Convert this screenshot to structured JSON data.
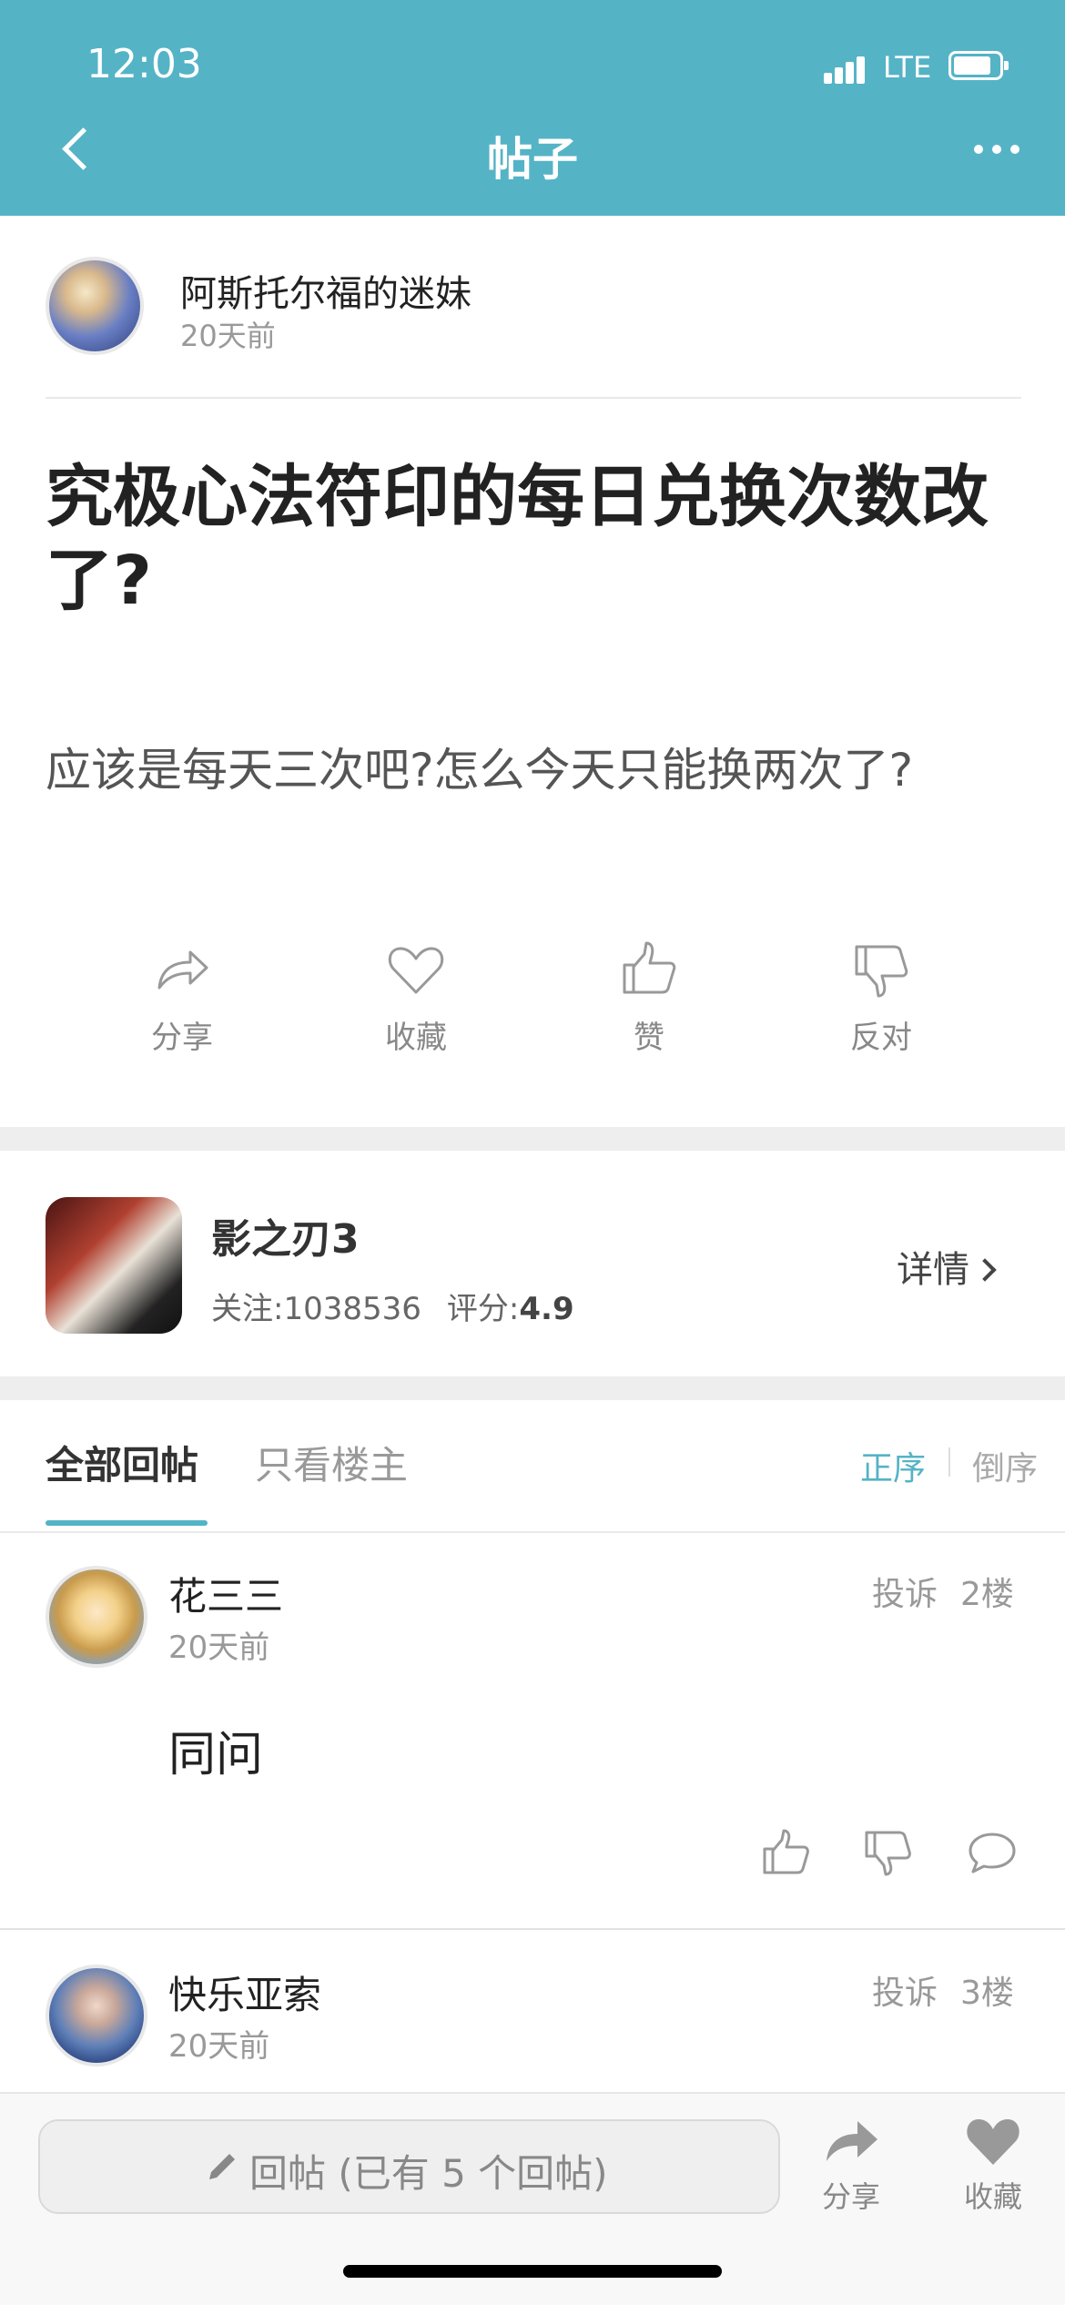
{
  "status_bar": {
    "time": "12:03",
    "network": "LTE"
  },
  "nav": {
    "title": "帖子"
  },
  "post": {
    "author_name": "阿斯托尔福的迷妹",
    "author_time": "20天前",
    "title": "究极心法符印的每日兑换次数改了?",
    "body": "应该是每天三次吧?怎么今天只能换两次了?"
  },
  "post_actions": [
    {
      "label": "分享",
      "icon": "share-icon"
    },
    {
      "label": "收藏",
      "icon": "heart-icon"
    },
    {
      "label": "赞",
      "icon": "thumbs-up-icon"
    },
    {
      "label": "反对",
      "icon": "thumbs-down-icon"
    }
  ],
  "game": {
    "name": "影之刃3",
    "follow_label": "关注:",
    "follow_count": "1038536",
    "rating_label": "评分:",
    "rating": "4.9",
    "details": "详情"
  },
  "tabs": {
    "all_replies": "全部回帖",
    "op_only": "只看楼主",
    "sort_asc": "正序",
    "sort_desc": "倒序"
  },
  "replies": [
    {
      "name": "花三三",
      "time": "20天前",
      "report": "投诉",
      "floor": "2楼",
      "text": "同问"
    },
    {
      "name": "快乐亚索",
      "time": "20天前",
      "report": "投诉",
      "floor": "3楼",
      "text": ""
    }
  ],
  "bottom_bar": {
    "reply_placeholder": "回帖 (已有 5 个回帖)",
    "share": "分享",
    "favorite": "收藏"
  },
  "colors": {
    "accent": "#55b3c6"
  }
}
